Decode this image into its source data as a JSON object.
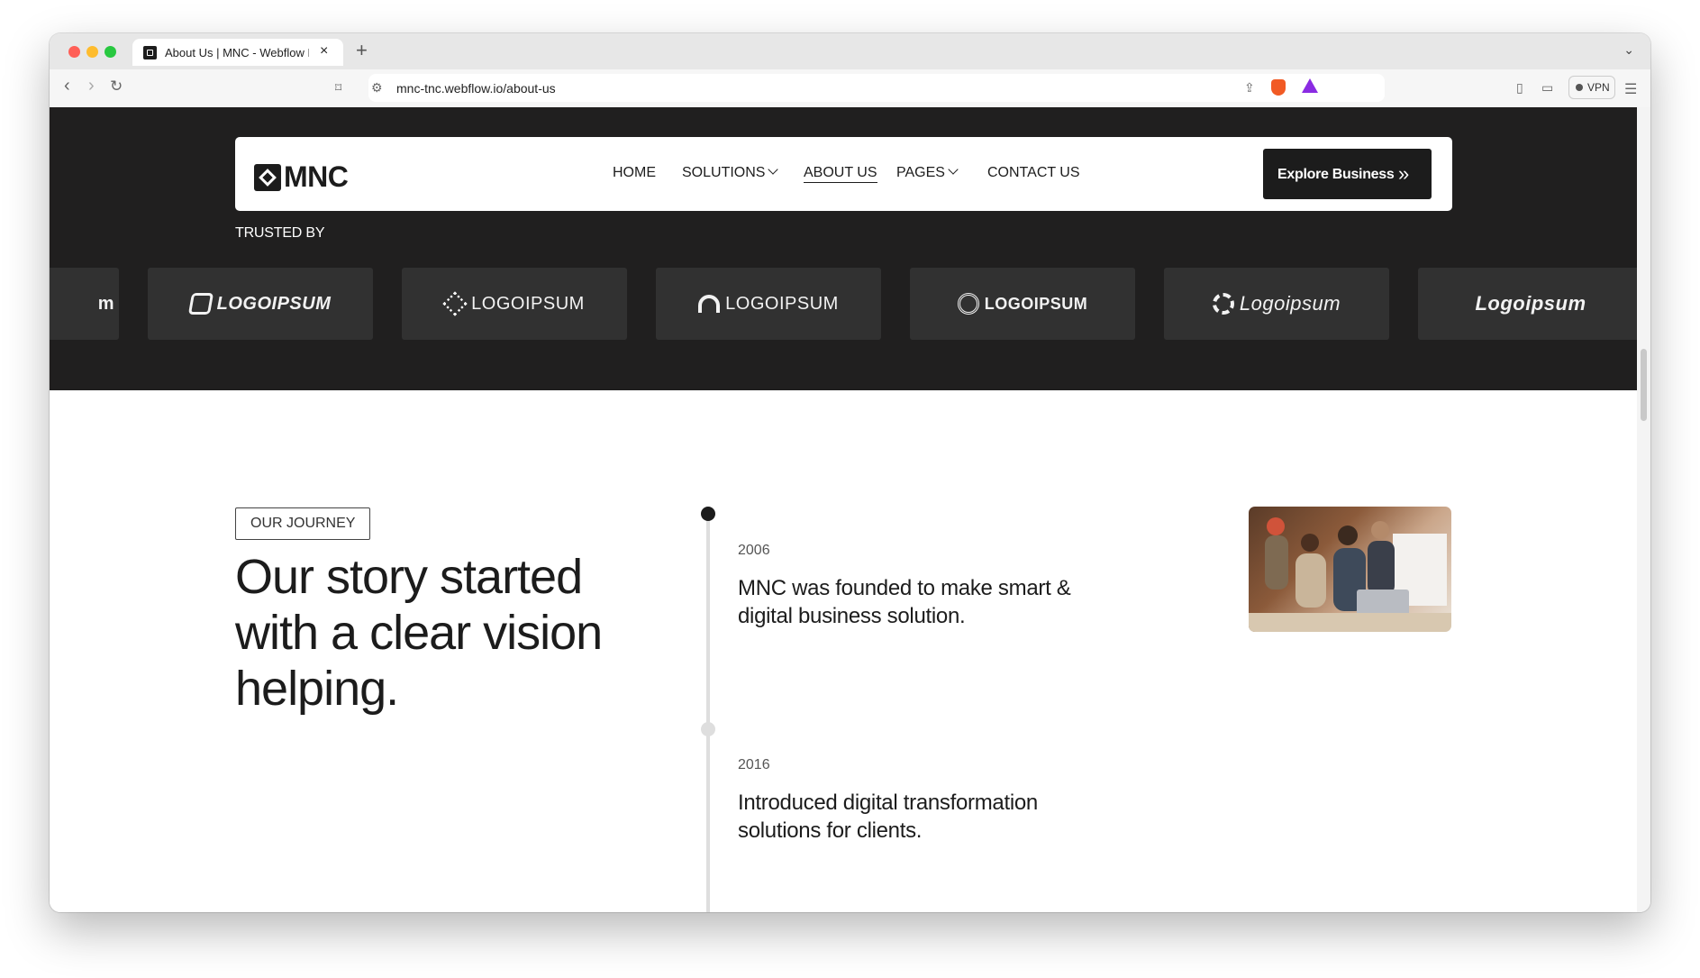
{
  "browser": {
    "tab_title": "About Us | MNC - Webflow H",
    "tab_close": "×",
    "new_tab": "+",
    "url": "mnc-tnc.webflow.io/about-us",
    "vpn_label": "VPN"
  },
  "header": {
    "logo_text": "MNC",
    "nav": {
      "home": "HOME",
      "solutions": "SOLUTIONS",
      "about": "ABOUT US",
      "pages": "PAGES",
      "contact": "CONTACT US"
    },
    "cta_label": "Explore Business",
    "cta_icon": "»"
  },
  "trusted": {
    "label": "TRUSTED BY",
    "logos": [
      "m",
      "LOGOIPSUM",
      "LOGOIPSUM",
      "LOGOIPSUM",
      "LOGOIPSUM",
      "Logoipsum",
      "Logoipsum"
    ]
  },
  "journey": {
    "badge": "OUR JOURNEY",
    "title": "Our story started with a clear vision helping.",
    "milestones": [
      {
        "year": "2006",
        "text": "MNC was founded to make smart & digital business solution."
      },
      {
        "year": "2016",
        "text": "Introduced digital transformation solutions for clients."
      }
    ]
  },
  "colors": {
    "dark_bg": "#201f1f",
    "logo_card_bg": "#313131",
    "text_dark": "#1c1c1c",
    "timeline_gray": "#dedede"
  },
  "icons": [
    "back-icon",
    "forward-icon",
    "reload-icon",
    "bookmark-icon",
    "site-settings-icon",
    "share-icon",
    "brave-shield-icon",
    "rewards-icon",
    "sidebar-icon",
    "wallet-icon",
    "menu-icon"
  ]
}
